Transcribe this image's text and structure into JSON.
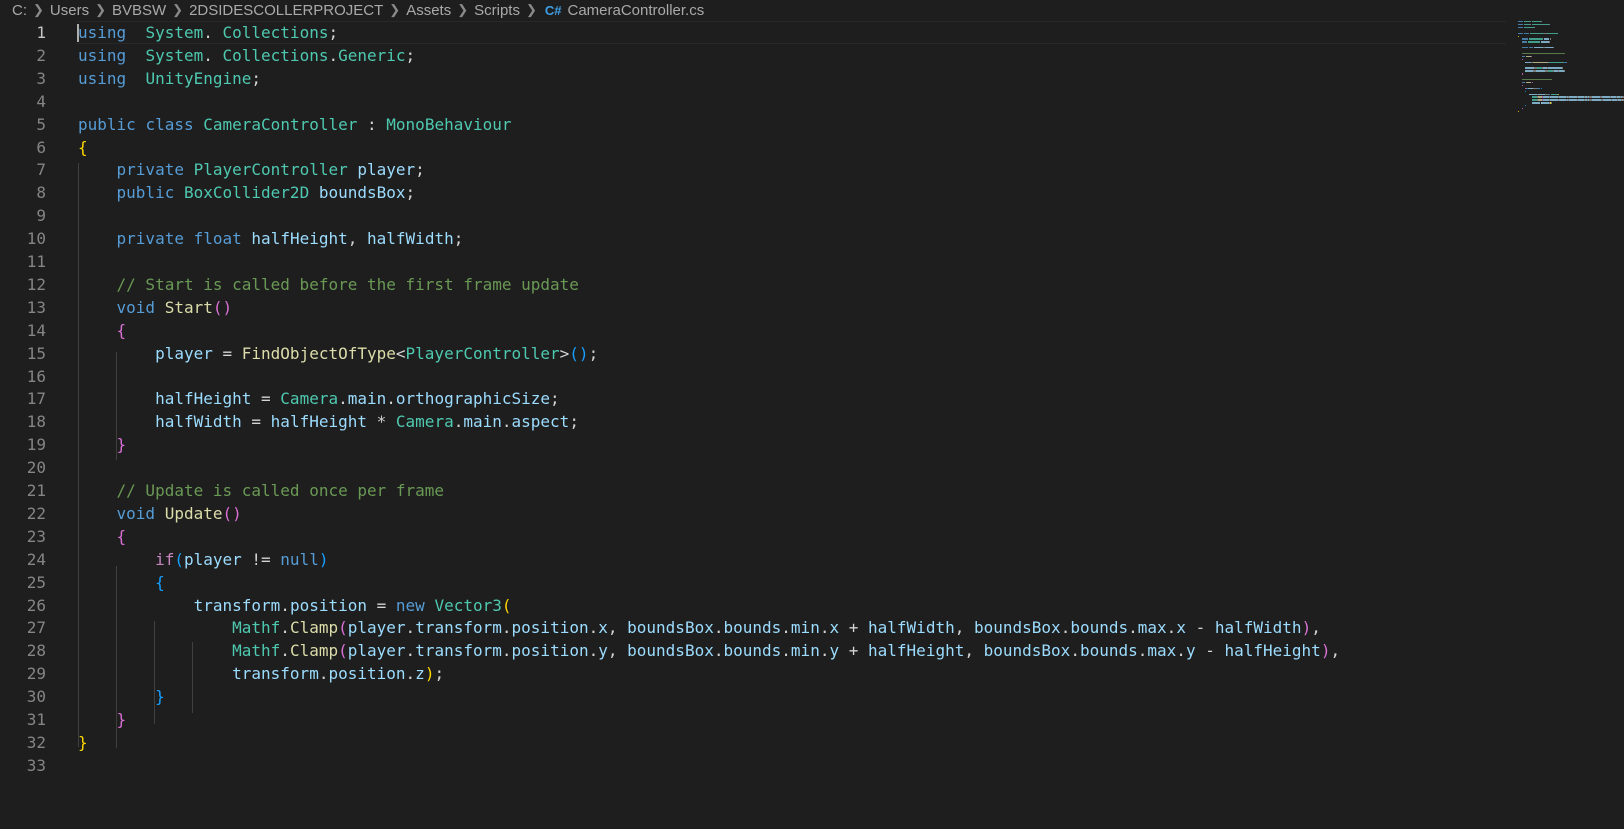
{
  "breadcrumb": {
    "items": [
      "C:",
      "Users",
      "BVBSW",
      "2DSIDESCOLLERPROJECT",
      "Assets",
      "Scripts"
    ],
    "file_icon": "C#",
    "file_name": "CameraController.cs"
  },
  "editor": {
    "active_line": 1,
    "lines": [
      {
        "n": "1",
        "t": [
          [
            "kw",
            "using"
          ],
          [
            "",
            "  "
          ],
          [
            "ty",
            "System"
          ],
          [
            "",
            ". "
          ],
          [
            "ty",
            "Collections"
          ],
          [
            "",
            ";"
          ]
        ]
      },
      {
        "n": "2",
        "t": [
          [
            "kw",
            "using"
          ],
          [
            "",
            "  "
          ],
          [
            "ty",
            "System"
          ],
          [
            "",
            ". "
          ],
          [
            "ty",
            "Collections"
          ],
          [
            "",
            "."
          ],
          [
            "ty",
            "Generic"
          ],
          [
            "",
            ";"
          ]
        ]
      },
      {
        "n": "3",
        "t": [
          [
            "kw",
            "using"
          ],
          [
            "",
            "  "
          ],
          [
            "ty",
            "UnityEngine"
          ],
          [
            "",
            ";"
          ]
        ]
      },
      {
        "n": "4",
        "t": []
      },
      {
        "n": "5",
        "t": [
          [
            "kw",
            "public"
          ],
          [
            "",
            " "
          ],
          [
            "kw",
            "class"
          ],
          [
            "",
            " "
          ],
          [
            "ty",
            "CameraController"
          ],
          [
            "",
            " : "
          ],
          [
            "ty",
            "MonoBehaviour"
          ]
        ]
      },
      {
        "n": "6",
        "t": [
          [
            "p1",
            "{"
          ]
        ]
      },
      {
        "n": "7",
        "t": [
          [
            "",
            "    "
          ],
          [
            "kw",
            "private"
          ],
          [
            "",
            " "
          ],
          [
            "ty",
            "PlayerController"
          ],
          [
            "",
            " "
          ],
          [
            "var",
            "player"
          ],
          [
            "",
            ";"
          ]
        ]
      },
      {
        "n": "8",
        "t": [
          [
            "",
            "    "
          ],
          [
            "kw",
            "public"
          ],
          [
            "",
            " "
          ],
          [
            "ty",
            "BoxCollider2D"
          ],
          [
            "",
            " "
          ],
          [
            "var",
            "boundsBox"
          ],
          [
            "",
            ";"
          ]
        ]
      },
      {
        "n": "9",
        "t": []
      },
      {
        "n": "10",
        "t": [
          [
            "",
            "    "
          ],
          [
            "kw",
            "private"
          ],
          [
            "",
            " "
          ],
          [
            "kw",
            "float"
          ],
          [
            "",
            " "
          ],
          [
            "var",
            "halfHeight"
          ],
          [
            "",
            ", "
          ],
          [
            "var",
            "halfWidth"
          ],
          [
            "",
            ";"
          ]
        ]
      },
      {
        "n": "11",
        "t": []
      },
      {
        "n": "12",
        "t": [
          [
            "",
            "    "
          ],
          [
            "cm",
            "// Start is called before the first frame update"
          ]
        ]
      },
      {
        "n": "13",
        "t": [
          [
            "",
            "    "
          ],
          [
            "kw",
            "void"
          ],
          [
            "",
            " "
          ],
          [
            "fn",
            "Start"
          ],
          [
            "p2",
            "()"
          ]
        ]
      },
      {
        "n": "14",
        "t": [
          [
            "",
            "    "
          ],
          [
            "p2",
            "{"
          ]
        ]
      },
      {
        "n": "15",
        "t": [
          [
            "",
            "        "
          ],
          [
            "var",
            "player"
          ],
          [
            "",
            " = "
          ],
          [
            "fn",
            "FindObjectOfType"
          ],
          [
            "",
            "<"
          ],
          [
            "ty",
            "PlayerController"
          ],
          [
            "",
            ">"
          ],
          [
            "p3",
            "()"
          ],
          [
            "",
            ";"
          ]
        ]
      },
      {
        "n": "16",
        "t": []
      },
      {
        "n": "17",
        "t": [
          [
            "",
            "        "
          ],
          [
            "var",
            "halfHeight"
          ],
          [
            "",
            " = "
          ],
          [
            "ty",
            "Camera"
          ],
          [
            "",
            "."
          ],
          [
            "var",
            "main"
          ],
          [
            "",
            "."
          ],
          [
            "var",
            "orthographicSize"
          ],
          [
            "",
            ";"
          ]
        ]
      },
      {
        "n": "18",
        "t": [
          [
            "",
            "        "
          ],
          [
            "var",
            "halfWidth"
          ],
          [
            "",
            " = "
          ],
          [
            "var",
            "halfHeight"
          ],
          [
            "",
            " * "
          ],
          [
            "ty",
            "Camera"
          ],
          [
            "",
            "."
          ],
          [
            "var",
            "main"
          ],
          [
            "",
            "."
          ],
          [
            "var",
            "aspect"
          ],
          [
            "",
            ";"
          ]
        ]
      },
      {
        "n": "19",
        "t": [
          [
            "",
            "    "
          ],
          [
            "p2",
            "}"
          ]
        ]
      },
      {
        "n": "20",
        "t": []
      },
      {
        "n": "21",
        "t": [
          [
            "",
            "    "
          ],
          [
            "cm",
            "// Update is called once per frame"
          ]
        ]
      },
      {
        "n": "22",
        "t": [
          [
            "",
            "    "
          ],
          [
            "kw",
            "void"
          ],
          [
            "",
            " "
          ],
          [
            "fn",
            "Update"
          ],
          [
            "p2",
            "()"
          ]
        ]
      },
      {
        "n": "23",
        "t": [
          [
            "",
            "    "
          ],
          [
            "p2",
            "{"
          ]
        ]
      },
      {
        "n": "24",
        "t": [
          [
            "",
            "        "
          ],
          [
            "ctl",
            "if"
          ],
          [
            "p3",
            "("
          ],
          [
            "var",
            "player"
          ],
          [
            "",
            " != "
          ],
          [
            "kw",
            "null"
          ],
          [
            "p3",
            ")"
          ]
        ]
      },
      {
        "n": "25",
        "t": [
          [
            "",
            "        "
          ],
          [
            "p3",
            "{"
          ]
        ]
      },
      {
        "n": "26",
        "t": [
          [
            "",
            "            "
          ],
          [
            "var",
            "transform"
          ],
          [
            "",
            "."
          ],
          [
            "var",
            "position"
          ],
          [
            "",
            " = "
          ],
          [
            "kw",
            "new"
          ],
          [
            "",
            " "
          ],
          [
            "ty",
            "Vector3"
          ],
          [
            "p1",
            "("
          ]
        ]
      },
      {
        "n": "27",
        "t": [
          [
            "",
            "                "
          ],
          [
            "ty",
            "Mathf"
          ],
          [
            "",
            "."
          ],
          [
            "fn",
            "Clamp"
          ],
          [
            "p2",
            "("
          ],
          [
            "var",
            "player"
          ],
          [
            "",
            "."
          ],
          [
            "var",
            "transform"
          ],
          [
            "",
            "."
          ],
          [
            "var",
            "position"
          ],
          [
            "",
            "."
          ],
          [
            "var",
            "x"
          ],
          [
            "",
            ", "
          ],
          [
            "var",
            "boundsBox"
          ],
          [
            "",
            "."
          ],
          [
            "var",
            "bounds"
          ],
          [
            "",
            "."
          ],
          [
            "var",
            "min"
          ],
          [
            "",
            "."
          ],
          [
            "var",
            "x"
          ],
          [
            "",
            " + "
          ],
          [
            "var",
            "halfWidth"
          ],
          [
            "",
            ", "
          ],
          [
            "var",
            "boundsBox"
          ],
          [
            "",
            "."
          ],
          [
            "var",
            "bounds"
          ],
          [
            "",
            "."
          ],
          [
            "var",
            "max"
          ],
          [
            "",
            "."
          ],
          [
            "var",
            "x"
          ],
          [
            "",
            " - "
          ],
          [
            "var",
            "halfWidth"
          ],
          [
            "p2",
            ")"
          ],
          [
            "",
            ","
          ]
        ]
      },
      {
        "n": "28",
        "t": [
          [
            "",
            "                "
          ],
          [
            "ty",
            "Mathf"
          ],
          [
            "",
            "."
          ],
          [
            "fn",
            "Clamp"
          ],
          [
            "p2",
            "("
          ],
          [
            "var",
            "player"
          ],
          [
            "",
            "."
          ],
          [
            "var",
            "transform"
          ],
          [
            "",
            "."
          ],
          [
            "var",
            "position"
          ],
          [
            "",
            "."
          ],
          [
            "var",
            "y"
          ],
          [
            "",
            ", "
          ],
          [
            "var",
            "boundsBox"
          ],
          [
            "",
            "."
          ],
          [
            "var",
            "bounds"
          ],
          [
            "",
            "."
          ],
          [
            "var",
            "min"
          ],
          [
            "",
            "."
          ],
          [
            "var",
            "y"
          ],
          [
            "",
            " + "
          ],
          [
            "var",
            "halfHeight"
          ],
          [
            "",
            ", "
          ],
          [
            "var",
            "boundsBox"
          ],
          [
            "",
            "."
          ],
          [
            "var",
            "bounds"
          ],
          [
            "",
            "."
          ],
          [
            "var",
            "max"
          ],
          [
            "",
            "."
          ],
          [
            "var",
            "y"
          ],
          [
            "",
            " - "
          ],
          [
            "var",
            "halfHeight"
          ],
          [
            "p2",
            ")"
          ],
          [
            "",
            ","
          ]
        ]
      },
      {
        "n": "29",
        "t": [
          [
            "",
            "                "
          ],
          [
            "var",
            "transform"
          ],
          [
            "",
            "."
          ],
          [
            "var",
            "position"
          ],
          [
            "",
            "."
          ],
          [
            "var",
            "z"
          ],
          [
            "p1",
            ")"
          ],
          [
            "",
            ";"
          ]
        ]
      },
      {
        "n": "30",
        "t": [
          [
            "",
            "        "
          ],
          [
            "p3",
            "}"
          ]
        ]
      },
      {
        "n": "31",
        "t": [
          [
            "",
            "    "
          ],
          [
            "p2",
            "}"
          ]
        ]
      },
      {
        "n": "32",
        "t": [
          [
            "p1",
            "}"
          ]
        ]
      },
      {
        "n": "33",
        "t": []
      }
    ]
  },
  "colors": {
    "background": "#1e1e1e",
    "keyword": "#569cd6",
    "type": "#4ec9b0",
    "function": "#dcdcaa",
    "variable": "#9cdcfe",
    "comment": "#6a9955",
    "control": "#c586c0"
  }
}
